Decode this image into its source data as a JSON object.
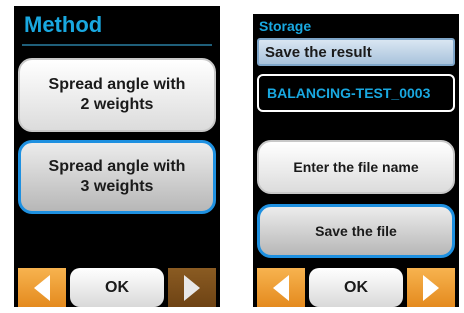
{
  "method_screen": {
    "title": "Method",
    "option1": "Spread angle with\n2 weights",
    "option2": "Spread angle with\n3 weights",
    "ok_label": "OK"
  },
  "storage_screen": {
    "title": "Storage",
    "result_label": "Save the result",
    "file_name": "BALANCING-TEST_0003",
    "enter_name_label": "Enter the file name",
    "save_label": "Save the file",
    "ok_label": "OK"
  },
  "colors": {
    "accent": "#19a8e0",
    "selected_border": "#1e90e0",
    "arrow_active": "#e48a1e",
    "screen_bg": "#000000"
  },
  "icons": [
    "left-arrow-icon",
    "right-arrow-icon"
  ]
}
